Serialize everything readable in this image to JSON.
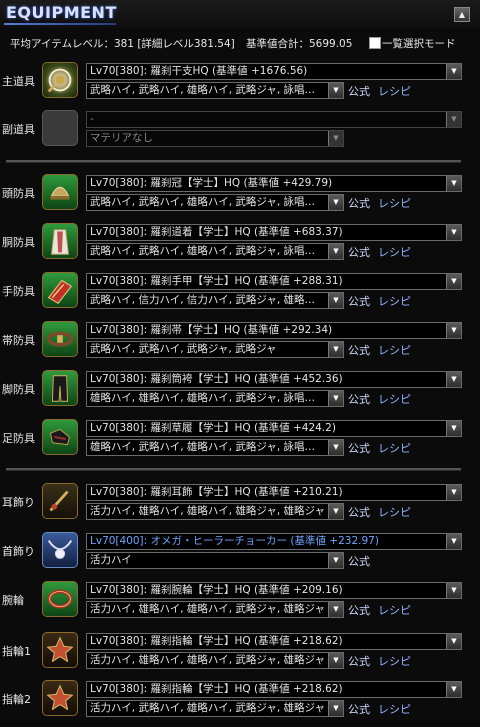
{
  "header": {
    "title": "EQUIPMENT",
    "collapse_glyph": "▲"
  },
  "stats": {
    "avg_label": "平均アイテムレベル：381 [詳細レベル381.54]",
    "total_label": "基準値合計：5699.05",
    "list_mode_label": "一覧選択モード"
  },
  "links": {
    "formula": "公式",
    "recipe": "レシピ"
  },
  "slots": [
    {
      "label": "主道具",
      "icon": "main-weapon-icon",
      "item": "Lv70[380]: 羅刹干支HQ (基準値 +1676.56)",
      "materia": "武略ハイ, 武略ハイ, 雄略ハイ, 武略ジャ, 詠唱…"
    },
    {
      "label": "副道具",
      "icon": "empty-slot-icon",
      "item": "-",
      "materia": "マテリアなし"
    },
    {
      "label": "頭防具",
      "icon": "head-armor-icon",
      "item": "Lv70[380]: 羅刹冠【学士】HQ (基準値 +429.79)",
      "materia": "武略ハイ, 武略ハイ, 雄略ハイ, 武略ジャ, 詠唱…"
    },
    {
      "label": "胴防具",
      "icon": "body-armor-icon",
      "item": "Lv70[380]: 羅刹道着【学士】HQ (基準値 +683.37)",
      "materia": "武略ハイ, 武略ハイ, 雄略ハイ, 武略ジャ, 詠唱…"
    },
    {
      "label": "手防具",
      "icon": "hand-armor-icon",
      "item": "Lv70[380]: 羅刹手甲【学士】HQ (基準値 +288.31)",
      "materia": "武略ハイ, 信力ハイ, 信力ハイ, 武略ジャ, 雄略…"
    },
    {
      "label": "帯防具",
      "icon": "waist-armor-icon",
      "item": "Lv70[380]: 羅刹帯【学士】HQ (基準値 +292.34)",
      "materia": "武略ハイ, 武略ハイ, 武略ジャ, 武略ジャ"
    },
    {
      "label": "脚防具",
      "icon": "leg-armor-icon",
      "item": "Lv70[380]: 羅刹筒袴【学士】HQ (基準値 +452.36)",
      "materia": "雄略ハイ, 雄略ハイ, 雄略ハイ, 武略ジャ, 詠唱…"
    },
    {
      "label": "足防具",
      "icon": "feet-armor-icon",
      "item": "Lv70[380]: 羅刹草履【学士】HQ (基準値 +424.2)",
      "materia": "雄略ハイ, 武略ハイ, 雄略ハイ, 武略ジャ, 詠唱…"
    },
    {
      "label": "耳飾り",
      "icon": "earring-icon",
      "item": "Lv70[380]: 羅刹耳飾【学士】HQ (基準値 +210.21)",
      "materia": "活力ハイ, 雄略ハイ, 雄略ハイ, 雄略ジャ, 雄略ジャ"
    },
    {
      "label": "首飾り",
      "icon": "necklace-icon",
      "item": "Lv70[400]: オメガ・ヒーラーチョーカー (基準値 +232.97)",
      "materia": "活力ハイ"
    },
    {
      "label": "腕輪",
      "icon": "bracelet-icon",
      "item": "Lv70[380]: 羅刹腕輪【学士】HQ (基準値 +209.16)",
      "materia": "活力ハイ, 雄略ハイ, 雄略ハイ, 武略ジャ, 雄略ジャ"
    },
    {
      "label": "指輪1",
      "icon": "ring-icon",
      "item": "Lv70[380]: 羅刹指輪【学士】HQ (基準値 +218.62)",
      "materia": "活力ハイ, 雄略ハイ, 雄略ハイ, 武略ジャ, 雄略ジャ"
    },
    {
      "label": "指輪2",
      "icon": "ring-icon",
      "item": "Lv70[380]: 羅刹指輪【学士】HQ (基準値 +218.62)",
      "materia": "活力ハイ, 武略ハイ, 雄略ハイ, 武略ジャ, 雄略ジャ"
    }
  ]
}
